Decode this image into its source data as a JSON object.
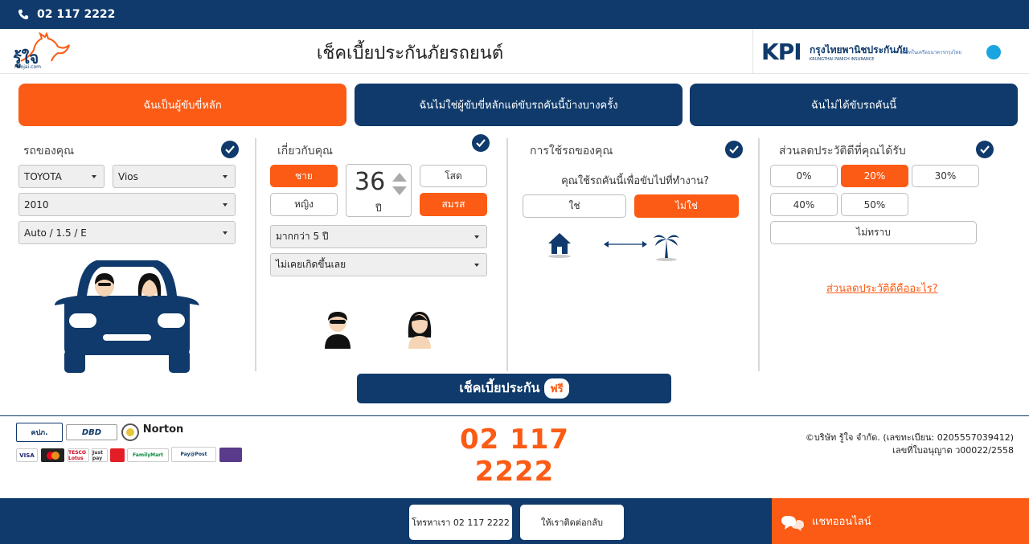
{
  "topbar": {
    "phone": "02 117 2222"
  },
  "header": {
    "logo_text": "รู้ใจ",
    "logo_sub": "Roojai.com",
    "title": "เช็คเบี้ยประกันภัยรถยนต์",
    "partner_logo": "KPI",
    "partner_name": "กรุงไทยพานิชประกันภัย",
    "partner_name_en": "KRUNGTHAI PANICH INSURANCE",
    "partner_group": "บริษัทในเครือธนาคารกรุงไทย"
  },
  "tabs": [
    {
      "label": "ฉันเป็นผู้ขับขี่หลัก",
      "active": true
    },
    {
      "label": "ฉันไม่ใช่ผู้ขับขี่หลักแต่ขับรถคันนี้บ้างบางครั้ง",
      "active": false
    },
    {
      "label": "ฉันไม่ได้ขับรถคันนี้",
      "active": false
    }
  ],
  "car": {
    "title": "รถของคุณ",
    "make": "TOYOTA",
    "model": "Vios",
    "year": "2010",
    "trim": "Auto / 1.5 / E"
  },
  "about": {
    "title": "เกี่ยวกับคุณ",
    "gender_male": "ชาย",
    "gender_female": "หญิง",
    "age": "36",
    "age_unit": "ปี",
    "single": "โสด",
    "married": "สมรส",
    "experience": "มากกว่า 5 ปี",
    "accidents": "ไม่เคยเกิดขึ้นเลย"
  },
  "usage": {
    "title": "การใช้รถของคุณ",
    "question": "คุณใช้รถคันนี้เพื่อขับไปที่ทำงาน?",
    "yes": "ใช่",
    "no": "ไม่ใช่"
  },
  "ncb": {
    "title": "ส่วนลดประวัติดีที่คุณได้รับ",
    "options": [
      "0%",
      "20%",
      "30%",
      "40%",
      "50%"
    ],
    "selected": "20%",
    "unknown": "ไม่ทราบ",
    "link": "ส่วนลดประวัติดีคืออะไร?"
  },
  "cta": {
    "label": "เช็คเบี้ยประกัน",
    "badge": "ฟรี"
  },
  "footer": {
    "big_phone": "02 117 2222",
    "copyright": "©บริษัท รู้ใจ จำกัด. (เลขทะเบียน: 0205557039412)",
    "license": "เลขที่ใบอนุญาต ว00022/2558",
    "badges": [
      "คปภ.",
      "DBD",
      "Norton",
      "VISA",
      "TESCO Lotus",
      "Just pay",
      "FamilyMart",
      "Pay@Post"
    ]
  },
  "bottombar": {
    "call_label": "โทรหาเรา 02 117 2222",
    "callback_label": "ให้เราติดต่อกลับ",
    "chat_label": "แชทออนไลน์"
  },
  "colors": {
    "navy": "#0f3a6b",
    "orange": "#fb5b14"
  }
}
